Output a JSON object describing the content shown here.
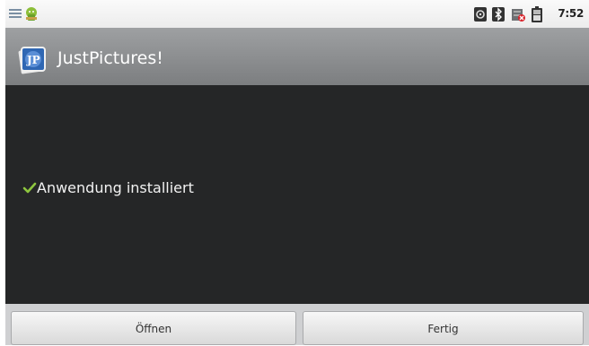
{
  "status_bar": {
    "time": "7:52",
    "left_icons": [
      "notification-list-icon",
      "android-icon"
    ],
    "right_icons": [
      "sd-card-icon",
      "bluetooth-icon",
      "no-sim-icon",
      "battery-icon"
    ]
  },
  "app": {
    "title": "JustPictures!",
    "icon": "justpictures-app-icon"
  },
  "install": {
    "message": "Anwendung installiert",
    "status_icon": "checkmark-icon"
  },
  "buttons": {
    "open_label": "Öffnen",
    "done_label": "Fertig"
  },
  "colors": {
    "content_bg": "#252627",
    "title_bg": "#8d8f91",
    "check_green": "#8ec63f"
  }
}
